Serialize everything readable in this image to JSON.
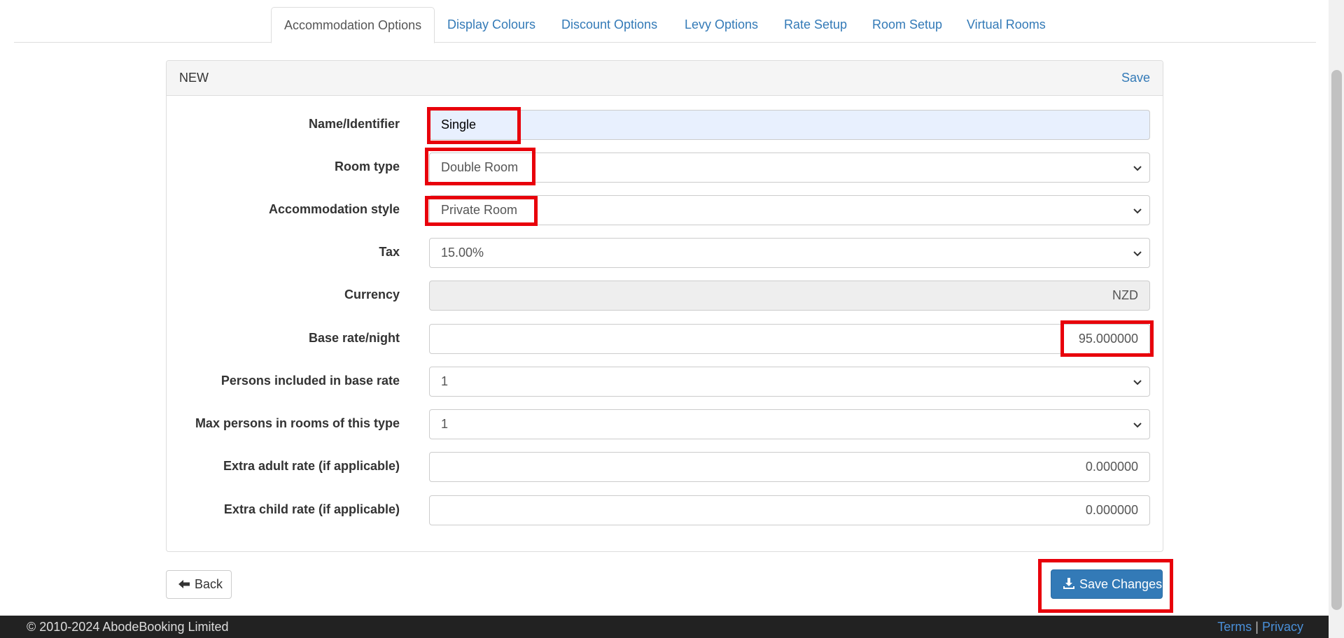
{
  "tabs": [
    {
      "label": "Accommodation Options",
      "active": true
    },
    {
      "label": "Display Colours"
    },
    {
      "label": "Discount Options"
    },
    {
      "label": "Levy Options"
    },
    {
      "label": "Rate Setup"
    },
    {
      "label": "Room Setup"
    },
    {
      "label": "Virtual Rooms"
    }
  ],
  "panel": {
    "title": "NEW",
    "save_link": "Save"
  },
  "form": {
    "name_label": "Name/Identifier",
    "name_value": "Single",
    "room_type_label": "Room type",
    "room_type_value": "Double Room",
    "accom_style_label": "Accommodation style",
    "accom_style_value": "Private Room",
    "tax_label": "Tax",
    "tax_value": "15.00%",
    "currency_label": "Currency",
    "currency_value": "NZD",
    "base_rate_label": "Base rate/night",
    "base_rate_value": "95.000000",
    "persons_included_label": "Persons included in base rate",
    "persons_included_value": "1",
    "max_persons_label": "Max persons in rooms of this type",
    "max_persons_value": "1",
    "extra_adult_label": "Extra adult rate (if applicable)",
    "extra_adult_value": "0.000000",
    "extra_child_label": "Extra child rate (if applicable)",
    "extra_child_value": "0.000000"
  },
  "buttons": {
    "back": "Back",
    "save_changes": "Save Changes"
  },
  "footer": {
    "copyright": "© 2010-2024 AbodeBooking Limited",
    "terms": "Terms",
    "separator": "|",
    "privacy": "Privacy"
  },
  "colors": {
    "link": "#337ab7",
    "primary": "#337ab7",
    "highlight": "#e8000b",
    "footer_bg": "#222222"
  },
  "icons": {
    "back": "arrow-left-icon",
    "save": "download-icon",
    "select": "chevron-down-icon"
  }
}
